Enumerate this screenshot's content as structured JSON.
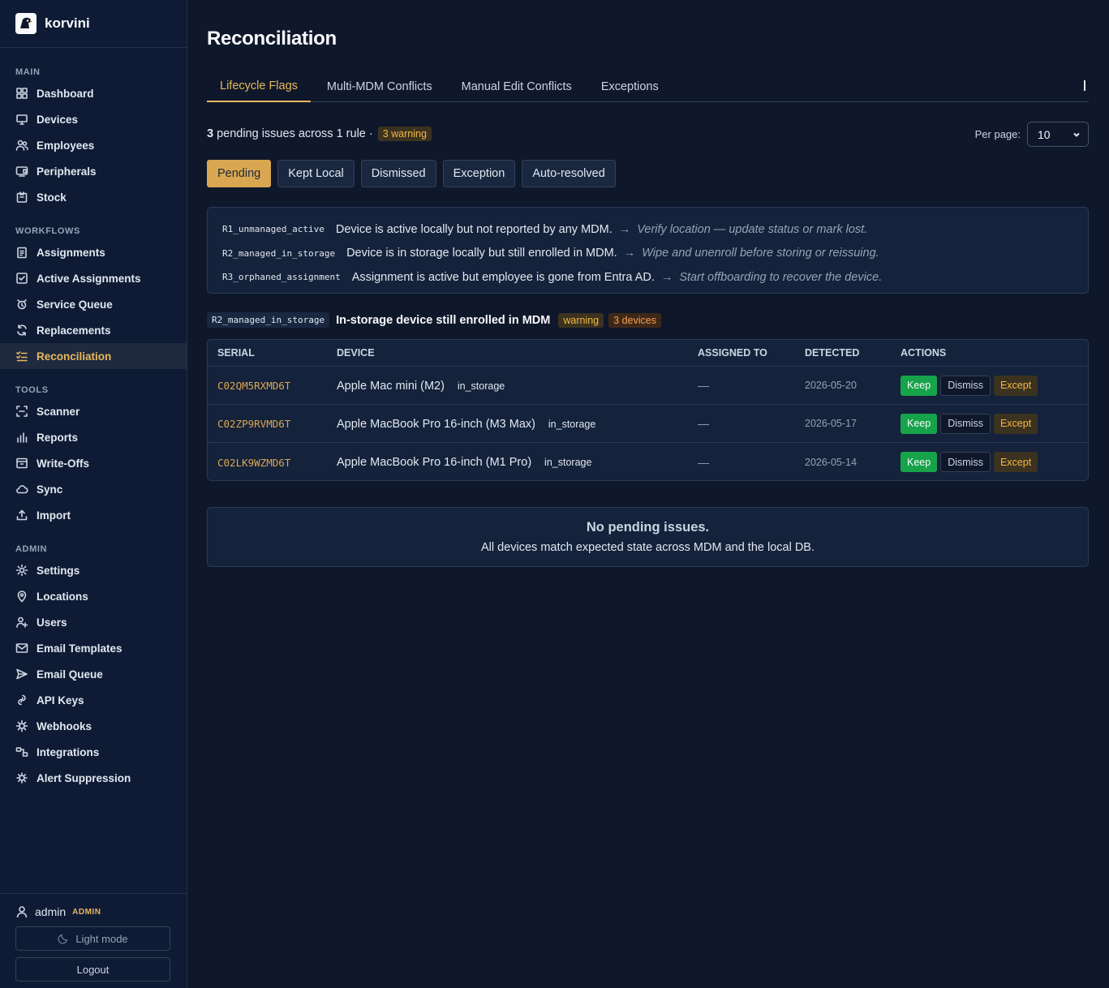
{
  "app": {
    "name": "korvini"
  },
  "sidebar": {
    "sections": [
      {
        "label": "MAIN",
        "items": [
          {
            "label": "Dashboard",
            "icon": "grid-icon"
          },
          {
            "label": "Devices",
            "icon": "monitor-icon"
          },
          {
            "label": "Employees",
            "icon": "people-icon"
          },
          {
            "label": "Peripherals",
            "icon": "peripheral-icon"
          },
          {
            "label": "Stock",
            "icon": "box-icon"
          }
        ]
      },
      {
        "label": "WORKFLOWS",
        "items": [
          {
            "label": "Assignments",
            "icon": "clipboard-icon"
          },
          {
            "label": "Active Assignments",
            "icon": "check-square-icon"
          },
          {
            "label": "Service Queue",
            "icon": "alarm-icon"
          },
          {
            "label": "Replacements",
            "icon": "refresh-icon"
          },
          {
            "label": "Reconciliation",
            "icon": "list-check-icon",
            "active": true
          }
        ]
      },
      {
        "label": "TOOLS",
        "items": [
          {
            "label": "Scanner",
            "icon": "scan-icon"
          },
          {
            "label": "Reports",
            "icon": "bar-chart-icon"
          },
          {
            "label": "Write-Offs",
            "icon": "archive-icon"
          },
          {
            "label": "Sync",
            "icon": "cloud-icon"
          },
          {
            "label": "Import",
            "icon": "upload-icon"
          }
        ]
      },
      {
        "label": "ADMIN",
        "items": [
          {
            "label": "Settings",
            "icon": "sun-gear-icon"
          },
          {
            "label": "Locations",
            "icon": "map-pin-icon"
          },
          {
            "label": "Users",
            "icon": "user-plus-icon"
          },
          {
            "label": "Email Templates",
            "icon": "mail-icon"
          },
          {
            "label": "Email Queue",
            "icon": "send-icon"
          },
          {
            "label": "API Keys",
            "icon": "link-icon"
          },
          {
            "label": "Webhooks",
            "icon": "webhook-icon"
          },
          {
            "label": "Integrations",
            "icon": "integrations-icon"
          },
          {
            "label": "Alert Suppression",
            "icon": "bug-icon"
          }
        ]
      }
    ],
    "user": {
      "name": "admin",
      "role": "ADMIN"
    },
    "light_mode_label": "Light mode",
    "logout_label": "Logout"
  },
  "page": {
    "title": "Reconciliation",
    "tabs": [
      "Lifecycle Flags",
      "Multi-MDM Conflicts",
      "Manual Edit Conflicts",
      "Exceptions"
    ],
    "summary": {
      "count": "3",
      "text": "pending issues across 1 rule ·",
      "badge": "3 warning"
    },
    "per_page": {
      "label": "Per page:",
      "value": "10"
    },
    "filters": [
      "Pending",
      "Kept Local",
      "Dismissed",
      "Exception",
      "Auto-resolved"
    ],
    "rules": [
      {
        "code": "R1_unmanaged_active",
        "description": "Device is active locally but not reported by any MDM.",
        "arrow": "→",
        "action": "Verify location — update status or mark lost."
      },
      {
        "code": "R2_managed_in_storage",
        "description": "Device is in storage locally but still enrolled in MDM.",
        "arrow": "→",
        "action": "Wipe and unenroll before storing or reissuing."
      },
      {
        "code": "R3_orphaned_assignment",
        "description": "Assignment is active but employee is gone from Entra AD.",
        "arrow": "→",
        "action": "Start offboarding to recover the device."
      }
    ],
    "group": {
      "code": "R2_managed_in_storage",
      "title": "In-storage device still enrolled in MDM",
      "severity": "warning",
      "count": "3 devices"
    },
    "table": {
      "headers": [
        "SERIAL",
        "DEVICE",
        "ASSIGNED TO",
        "DETECTED",
        "ACTIONS"
      ],
      "rows": [
        {
          "serial": "C02QM5RXMD6T",
          "device": "Apple Mac mini (M2)",
          "status": "in_storage",
          "assigned": "—",
          "detected": "2026-05-20"
        },
        {
          "serial": "C02ZP9RVMD6T",
          "device": "Apple MacBook Pro 16-inch (M3 Max)",
          "status": "in_storage",
          "assigned": "—",
          "detected": "2026-05-17"
        },
        {
          "serial": "C02LK9WZMD6T",
          "device": "Apple MacBook Pro 16-inch (M1 Pro)",
          "status": "in_storage",
          "assigned": "—",
          "detected": "2026-05-14"
        }
      ],
      "actions": {
        "keep": "Keep",
        "dismiss": "Dismiss",
        "except": "Except"
      }
    },
    "empty": {
      "title": "No pending issues.",
      "subtitle": "All devices match expected state across MDM and the local DB."
    }
  }
}
